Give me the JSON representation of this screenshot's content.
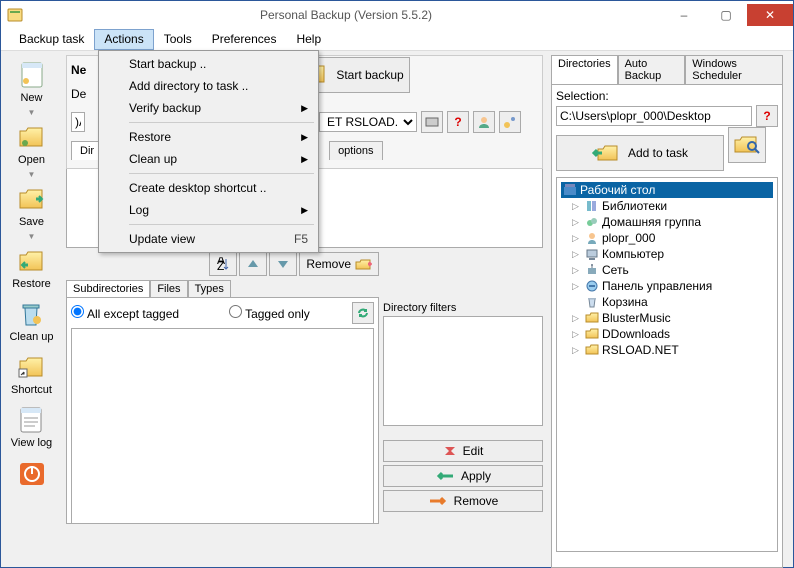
{
  "title": "Personal Backup (Version 5.5.2)",
  "menubar": [
    "Backup task",
    "Actions",
    "Tools",
    "Preferences",
    "Help"
  ],
  "menubar_active": 1,
  "side_toolbar": [
    {
      "label": "New"
    },
    {
      "label": "Open"
    },
    {
      "label": "Save"
    },
    {
      "label": "Restore"
    },
    {
      "label": "Clean up"
    },
    {
      "label": "Shortcut"
    },
    {
      "label": "View log"
    }
  ],
  "actions_menu": [
    {
      "label": "Start backup ..",
      "type": "item"
    },
    {
      "label": "Add directory to task ..",
      "type": "item"
    },
    {
      "label": "Verify backup",
      "type": "sub"
    },
    {
      "type": "sep"
    },
    {
      "label": "Restore",
      "type": "sub"
    },
    {
      "label": "Clean up",
      "type": "sub"
    },
    {
      "type": "sep"
    },
    {
      "label": "Create desktop shortcut ..",
      "type": "item"
    },
    {
      "label": "Log",
      "type": "sub"
    },
    {
      "type": "sep"
    },
    {
      "label": "Update view",
      "type": "item",
      "shortcut": "F5"
    }
  ],
  "left": {
    "start_btn": "Start backup",
    "new_tab_prefix": "Ne",
    "dest_prefix": "De",
    "path_fragment": ")A",
    "dest_combo": "ET RSLOAD.NET",
    "dir_prefix": "Dir",
    "tab_options_suffix": "options",
    "remove_btn": "Remove",
    "subtabs": [
      "Subdirectories",
      "Files",
      "Types"
    ],
    "subtabs_active": 0,
    "mode_all": "All except tagged",
    "mode_tagged": "Tagged only",
    "filters_label": "Directory filters",
    "filter_buttons": {
      "edit": "Edit",
      "apply": "Apply",
      "remove": "Remove"
    }
  },
  "right": {
    "tabs": [
      "Directories",
      "Auto Backup",
      "Windows Scheduler"
    ],
    "tabs_active": 0,
    "selection_label": "Selection:",
    "path": "C:\\Users\\plopr_000\\Desktop",
    "add_task": "Add to task",
    "tree_root": "Рабочий стол",
    "tree": [
      {
        "label": "Библиотеки",
        "icon": "library"
      },
      {
        "label": "Домашняя группа",
        "icon": "homegroup"
      },
      {
        "label": "plopr_000",
        "icon": "user"
      },
      {
        "label": "Компьютер",
        "icon": "computer"
      },
      {
        "label": "Сеть",
        "icon": "network"
      },
      {
        "label": "Панель управления",
        "icon": "control"
      },
      {
        "label": "Корзина",
        "icon": "trash"
      },
      {
        "label": "BlusterMusic",
        "icon": "folder"
      },
      {
        "label": "DDownloads",
        "icon": "folder"
      },
      {
        "label": "RSLOAD.NET",
        "icon": "folder"
      }
    ]
  }
}
